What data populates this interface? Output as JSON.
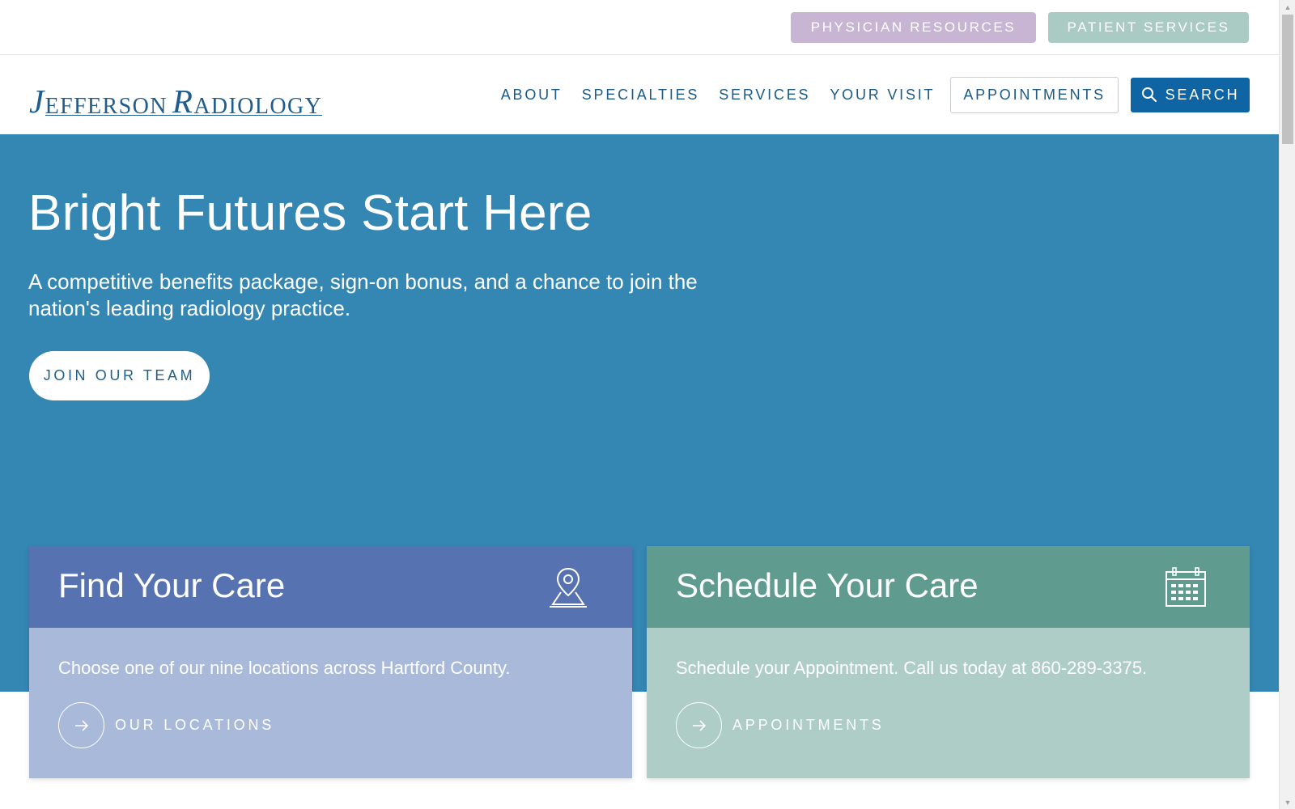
{
  "colors": {
    "physician_btn": "#c7b5d3",
    "patient_btn": "#a9cbc3",
    "brand_blue": "#1f5d8f",
    "search_btn": "#0f64a4",
    "hero_bg": "#3486b3",
    "find_head": "#5672b0",
    "find_body": "#a9b9d9",
    "schedule_head": "#5f9b8e",
    "schedule_body": "#aecdc6",
    "cta_text": "#1f5f8a"
  },
  "utility": {
    "physician_label": "PHYSICIAN RESOURCES",
    "patient_label": "PATIENT SERVICES"
  },
  "logo": {
    "j": "J",
    "efferson": "EFFERSON",
    "r": "R",
    "adiology": "ADIOLOGY"
  },
  "nav": {
    "items": [
      "ABOUT",
      "SPECIALTIES",
      "SERVICES",
      "YOUR VISIT"
    ],
    "appointments_label": "APPOINTMENTS",
    "search_label": "SEARCH",
    "search_icon": "search-icon"
  },
  "hero": {
    "title": "Bright Futures Start Here",
    "subtitle": "A competitive benefits package, sign-on bonus, and a chance to join the nation's leading radiology practice.",
    "cta_label": "JOIN OUR TEAM"
  },
  "cards": {
    "find": {
      "title": "Find Your Care",
      "icon": "map-pin-icon",
      "text": "Choose one of our nine locations across Hartford County.",
      "link_label": "OUR LOCATIONS"
    },
    "schedule": {
      "title": "Schedule Your Care",
      "icon": "calendar-icon",
      "text": "Schedule your Appointment. Call us today at 860-289-3375.",
      "link_label": "APPOINTMENTS"
    }
  }
}
